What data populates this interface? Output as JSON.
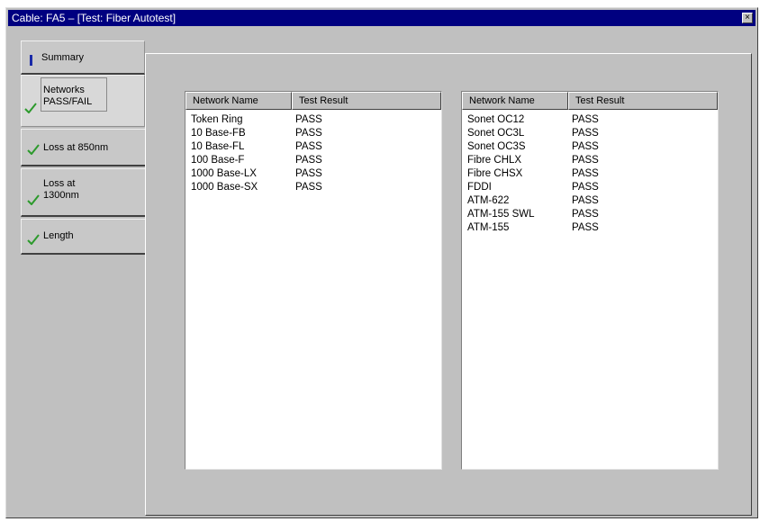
{
  "window": {
    "title": "Cable: FA5 – [Test: Fiber Autotest]",
    "close_glyph": "×"
  },
  "tabs": [
    {
      "label": "Summary",
      "icon": "info-icon"
    },
    {
      "label": "Networks\nPASS/FAIL",
      "icon": "check-icon",
      "selected": true
    },
    {
      "label": "Loss at 850nm",
      "icon": "check-icon"
    },
    {
      "label": "Loss at\n1300nm",
      "icon": "check-icon"
    },
    {
      "label": "Length",
      "icon": "check-icon"
    }
  ],
  "colors": {
    "title_bar": "#000080",
    "check": "#2c9a2c",
    "info": "#1a2aa8"
  },
  "table_left": {
    "columns": [
      "Network Name",
      "Test Result"
    ],
    "rows": [
      [
        "Token Ring",
        "PASS"
      ],
      [
        "10 Base-FB",
        "PASS"
      ],
      [
        "10 Base-FL",
        "PASS"
      ],
      [
        "100 Base-F",
        "PASS"
      ],
      [
        "1000 Base-LX",
        "PASS"
      ],
      [
        "1000 Base-SX",
        "PASS"
      ]
    ]
  },
  "table_right": {
    "columns": [
      "Network Name",
      "Test Result"
    ],
    "rows": [
      [
        "Sonet OC12",
        "PASS"
      ],
      [
        "Sonet OC3L",
        "PASS"
      ],
      [
        "Sonet OC3S",
        "PASS"
      ],
      [
        "Fibre CHLX",
        "PASS"
      ],
      [
        "Fibre CHSX",
        "PASS"
      ],
      [
        "FDDI",
        "PASS"
      ],
      [
        "ATM-622",
        "PASS"
      ],
      [
        "ATM-155 SWL",
        "PASS"
      ],
      [
        "ATM-155",
        "PASS"
      ]
    ]
  }
}
